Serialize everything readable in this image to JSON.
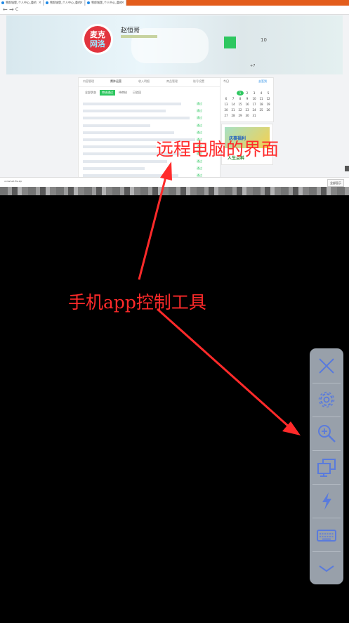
{
  "browser": {
    "tabs": [
      {
        "label": "雪郎城堡_个人中心_重的"
      },
      {
        "label": "雪郎城堡_个人中心_重的"
      },
      {
        "label": "雪郎城堡_个人中心_重的"
      }
    ],
    "close_glyph": "×",
    "nav_back": "←",
    "nav_forward": "→",
    "nav_reload": "C"
  },
  "profile": {
    "avatar_line1": "麦克",
    "avatar_line2": "网洛",
    "username": "赵恒哥",
    "stat1": "10",
    "stat2": "+7"
  },
  "panel": {
    "tabs": [
      "内容管理",
      "鹰阵运营",
      "收入明细",
      "商品管理",
      "账号设置"
    ],
    "chips": [
      "全部状态",
      "审核通过",
      "待审核",
      "已驳回"
    ],
    "row_status": "通过",
    "rows": 11
  },
  "calendar": {
    "header": "今日",
    "link": "去签到",
    "today": "1",
    "days": [
      "",
      "",
      "",
      "",
      "",
      "",
      "",
      "",
      "",
      "1",
      "2",
      "3",
      "4",
      "5",
      "6",
      "7",
      "8",
      "9",
      "10",
      "11",
      "12",
      "13",
      "14",
      "15",
      "16",
      "17",
      "18",
      "19",
      "20",
      "21",
      "22",
      "23",
      "24",
      "25",
      "26",
      "27",
      "28",
      "29",
      "30",
      "31",
      "",
      ""
    ]
  },
  "ad": {
    "line1": "庆事福利",
    "line2": "人生点料"
  },
  "download": {
    "filename": "unnamed-file.zip",
    "button": "全部显示"
  },
  "annotations": {
    "remote_label": "远程电脑的界面",
    "tool_label": "手机app控制工具"
  },
  "toolbar": {
    "buttons": [
      {
        "icon": "close-icon"
      },
      {
        "icon": "gear-icon"
      },
      {
        "icon": "zoom-in-icon"
      },
      {
        "icon": "switch-screen-icon"
      },
      {
        "icon": "lightning-icon"
      },
      {
        "icon": "keyboard-icon"
      },
      {
        "icon": "chevron-down-icon"
      }
    ]
  },
  "colors": {
    "accent_green": "#2ec760",
    "annotation_red": "#ff2a2a",
    "toolbar_gray": "#98a0aa",
    "icon_blue": "#5a7bdc",
    "avatar_red": "#e2343e"
  }
}
